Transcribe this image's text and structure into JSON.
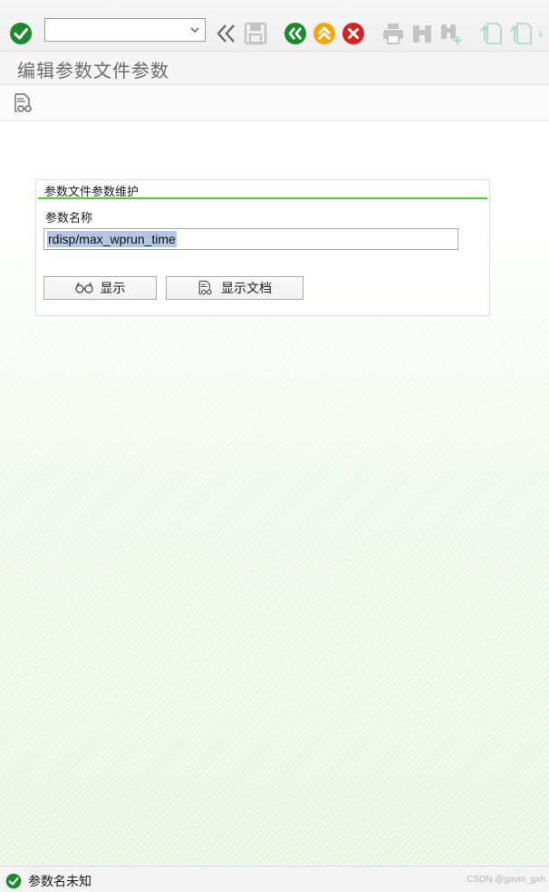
{
  "toolbar": {
    "command_field_value": "",
    "buttons": [
      {
        "name": "enter-icon",
        "color": "#1b8a2d"
      },
      {
        "name": "back-icon",
        "color": "#1b8a2d"
      },
      {
        "name": "exit-icon",
        "color": "#f1a80e"
      },
      {
        "name": "cancel-icon",
        "color": "#d32323"
      }
    ]
  },
  "title": {
    "text": "编辑参数文件参数"
  },
  "group": {
    "title": "参数文件参数维护",
    "param_label": "参数名称",
    "param_value": "rdisp/max_wprun_time",
    "display_button": "显示",
    "doc_button": "显示文档"
  },
  "status": {
    "message": "参数名未知",
    "watermark": "CSDN @gavin_gxh"
  },
  "colors": {
    "accent_green": "#4ccf2e",
    "selection": "#b3c6e6"
  }
}
